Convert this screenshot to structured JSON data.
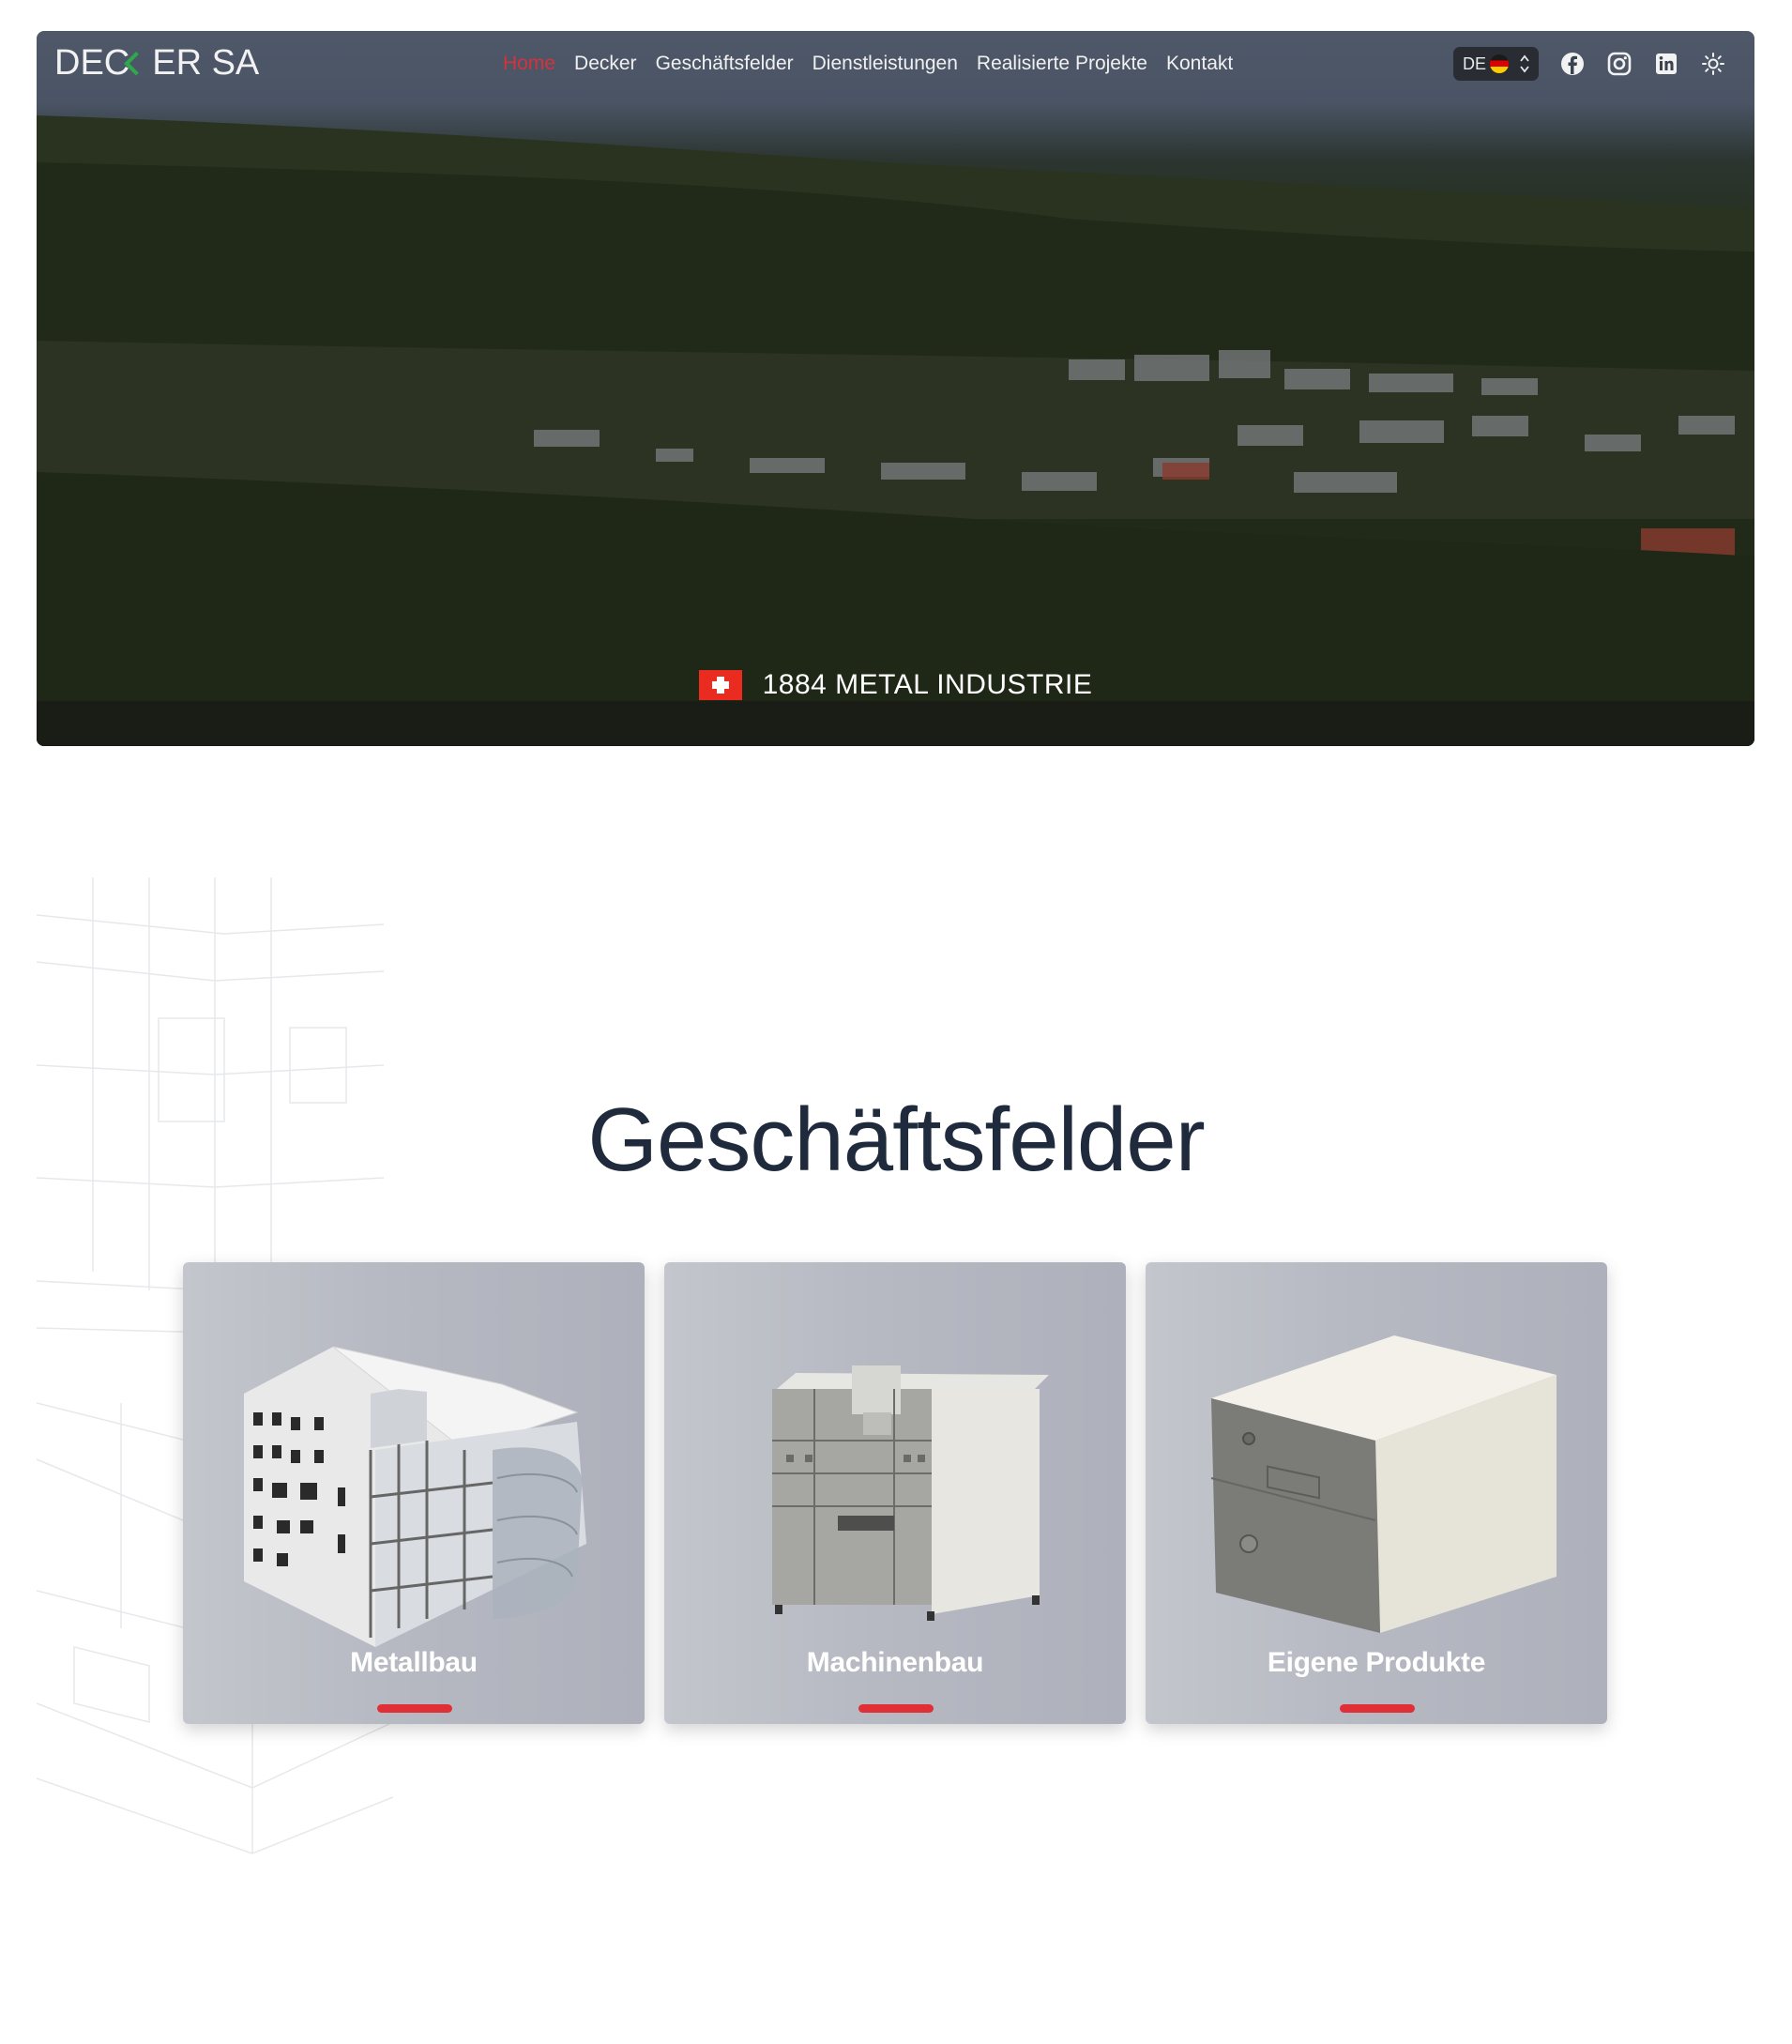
{
  "brand": {
    "logo_left": "DEC",
    "logo_right": "ER SA"
  },
  "nav": {
    "items": [
      {
        "label": "Home",
        "active": true
      },
      {
        "label": "Decker",
        "active": false
      },
      {
        "label": "Geschäftsfelder",
        "active": false
      },
      {
        "label": "Dienstleistungen",
        "active": false
      },
      {
        "label": "Realisierte Projekte",
        "active": false
      },
      {
        "label": "Kontakt",
        "active": false
      }
    ],
    "language": "DE",
    "icons": [
      "facebook-icon",
      "instagram-icon",
      "linkedin-icon",
      "sun-icon"
    ]
  },
  "hero": {
    "tagline": "1884 METAL INDUSTRIE"
  },
  "section": {
    "title": "Geschäftsfelder",
    "cards": [
      {
        "label": "Metallbau"
      },
      {
        "label": "Machinenbau"
      },
      {
        "label": "Eigene Produkte"
      }
    ]
  },
  "colors": {
    "accent": "#e12f37",
    "title": "#1f2a3d",
    "logo_accent": "#2ea84a"
  }
}
